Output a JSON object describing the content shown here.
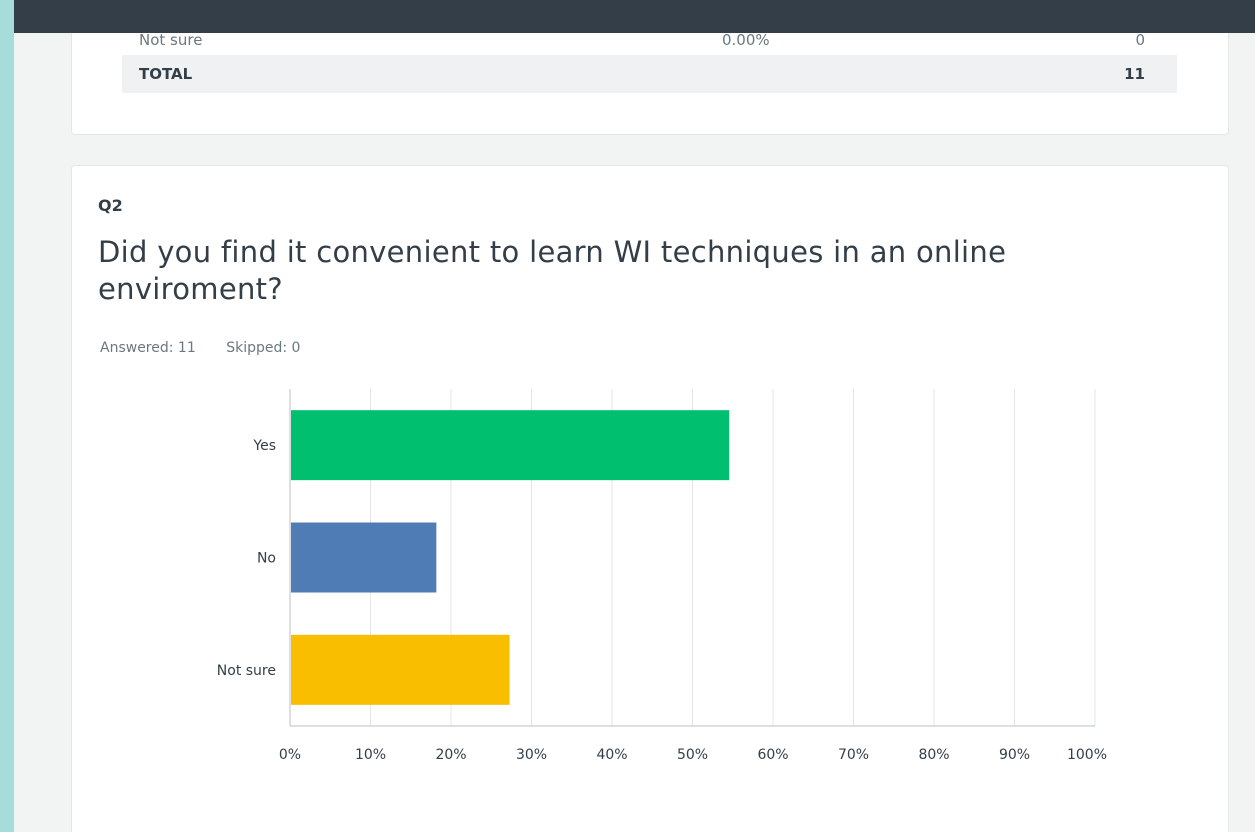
{
  "prev_table": {
    "rows": [
      {
        "label": "Not sure",
        "percent": "0.00%",
        "count": "0"
      }
    ],
    "total": {
      "label": "TOTAL",
      "count": "11"
    }
  },
  "question": {
    "number": "Q2",
    "title": "Did you find it convenient to learn WI techniques in an online enviroment?",
    "answered": "Answered: 11",
    "skipped": "Skipped: 0"
  },
  "chart_data": {
    "type": "bar",
    "orientation": "horizontal",
    "categories": [
      "Yes",
      "No",
      "Not sure"
    ],
    "values": [
      54.55,
      18.18,
      27.27
    ],
    "colors": [
      "#00bf6f",
      "#507cb6",
      "#f9be00"
    ],
    "xlim": [
      0,
      100
    ],
    "x_ticks": [
      "0%",
      "10%",
      "20%",
      "30%",
      "40%",
      "50%",
      "60%",
      "70%",
      "80%",
      "90%",
      "100%"
    ],
    "grid": true
  }
}
